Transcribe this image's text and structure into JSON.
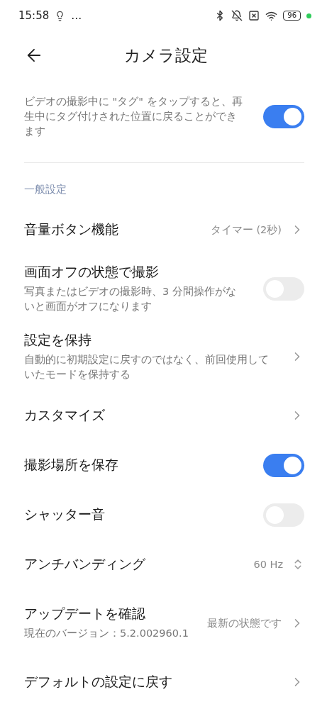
{
  "status_bar": {
    "time": "15:58",
    "more": "…",
    "battery": "96"
  },
  "header": {
    "title": "カメラ設定"
  },
  "top_item": {
    "description": "ビデオの撮影中に \"タグ\" をタップすると、再生中にタグ付けされた位置に戻ることができます",
    "on": true
  },
  "section": {
    "title": "一般設定"
  },
  "items": [
    {
      "kind": "link",
      "title": "音量ボタン機能",
      "value": "タイマー (2秒)"
    },
    {
      "kind": "toggle",
      "title": "画面オフの状態で撮影",
      "description": "写真またはビデオの撮影時、3 分間操作がないと画面がオフになります",
      "on": false
    },
    {
      "kind": "link",
      "title": "設定を保持",
      "description": "自動的に初期設定に戻すのではなく、前回使用していたモードを保持する"
    },
    {
      "kind": "link",
      "title": "カスタマイズ"
    },
    {
      "kind": "toggle",
      "title": "撮影場所を保存",
      "on": true
    },
    {
      "kind": "toggle",
      "title": "シャッター音",
      "on": false
    },
    {
      "kind": "select",
      "title": "アンチバンディング",
      "value": "60 Hz"
    },
    {
      "kind": "link",
      "title": "アップデートを確認",
      "description": "現在のバージョン：5.2.002960.1",
      "value": "最新の状態です"
    },
    {
      "kind": "link",
      "title": "デフォルトの設定に戻す"
    }
  ]
}
